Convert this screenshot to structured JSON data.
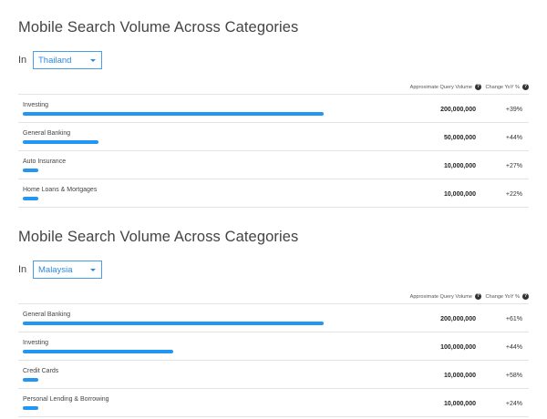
{
  "columns": {
    "volume_label": "Approximate Query Volume",
    "change_label": "Change YoY %",
    "help_glyph": "?"
  },
  "chart_data": [
    {
      "type": "bar",
      "title": "Mobile Search Volume Across Categories",
      "filter_label": "In",
      "selected_region": "Thailand",
      "categories": [
        "Investing",
        "General Banking",
        "Auto Insurance",
        "Home Loans & Mortgages"
      ],
      "values": [
        200000000,
        50000000,
        10000000,
        10000000
      ],
      "value_labels": [
        "200,000,000",
        "50,000,000",
        "10,000,000",
        "10,000,000"
      ],
      "change_labels": [
        "+39%",
        "+44%",
        "+27%",
        "+22%"
      ],
      "xlim": [
        0,
        200000000
      ],
      "bar_color": "#2196f3"
    },
    {
      "type": "bar",
      "title": "Mobile Search Volume Across Categories",
      "filter_label": "In",
      "selected_region": "Malaysia",
      "categories": [
        "General Banking",
        "Investing",
        "Credit Cards",
        "Personal Lending & Borrowing"
      ],
      "values": [
        200000000,
        100000000,
        10000000,
        10000000
      ],
      "value_labels": [
        "200,000,000",
        "100,000,000",
        "10,000,000",
        "10,000,000"
      ],
      "change_labels": [
        "+61%",
        "+44%",
        "+58%",
        "+24%"
      ],
      "xlim": [
        0,
        200000000
      ],
      "bar_color": "#2196f3"
    }
  ]
}
